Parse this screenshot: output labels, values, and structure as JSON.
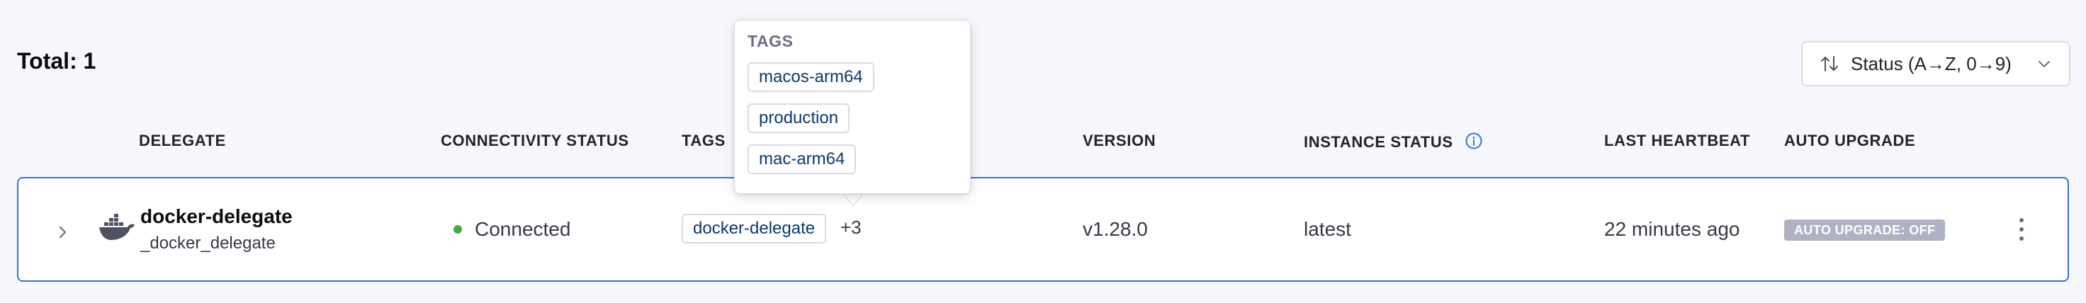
{
  "summary": {
    "total_label": "Total: 1"
  },
  "sort": {
    "label": "Status (A→Z, 0→9)"
  },
  "columns": {
    "delegate": "DELEGATE",
    "connectivity": "CONNECTIVITY STATUS",
    "tags": "TAGS",
    "version": "VERSION",
    "instance_status": "INSTANCE STATUS",
    "last_heartbeat": "LAST HEARTBEAT",
    "auto_upgrade": "AUTO UPGRADE"
  },
  "row": {
    "name": "docker-delegate",
    "identifier": "_docker_delegate",
    "icon": "docker-icon",
    "connectivity": "Connected",
    "tag": "docker-delegate",
    "more_tags": "+3",
    "version": "v1.28.0",
    "instance_status": "latest",
    "last_heartbeat": "22 minutes ago",
    "auto_upgrade": "AUTO UPGRADE: OFF"
  },
  "tags_popover": {
    "title": "TAGS",
    "tags": [
      "macos-arm64",
      "production",
      "mac-arm64"
    ]
  },
  "colors": {
    "accent_border": "#2f77d6",
    "connected_dot": "#42ab45",
    "badge_bg": "#b0b1c4",
    "tag_text": "#0b3a6e"
  }
}
